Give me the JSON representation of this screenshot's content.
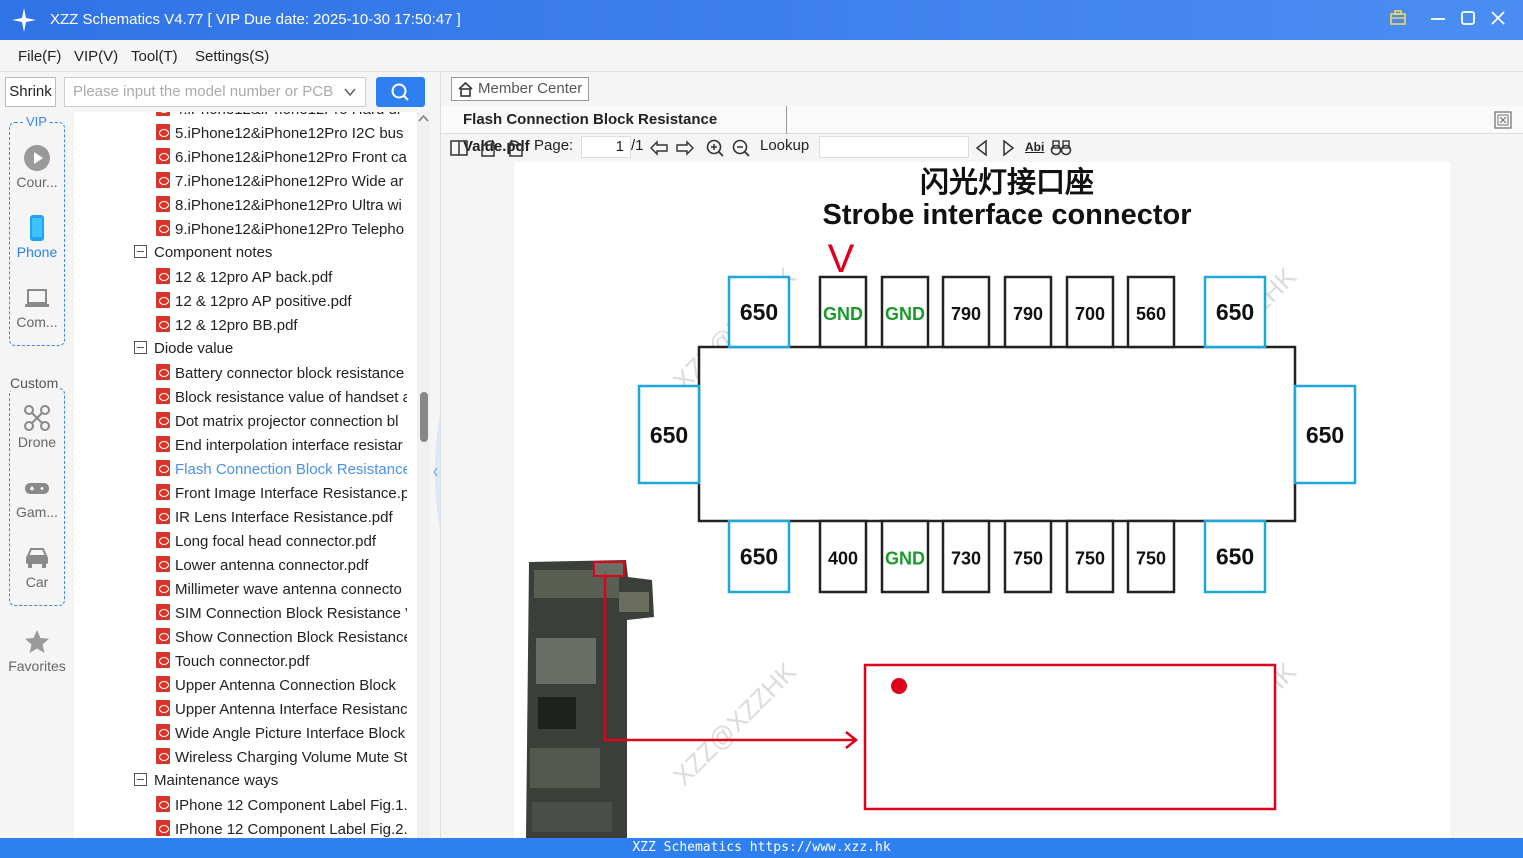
{
  "window": {
    "title": "XZZ Schematics V4.77 [ VIP Due date: 2025-10-30 17:50:47 ]"
  },
  "menu": [
    "File(F)",
    "VIP(V)",
    "Tool(T)",
    "Settings(S)"
  ],
  "left": {
    "shrink_label": "Shrink",
    "search_placeholder": "Please input the model number or PCB"
  },
  "sidebar": {
    "vip_label": "VIP",
    "custom_label": "Custom",
    "items": [
      {
        "label": "Cour...",
        "icon": "play-icon"
      },
      {
        "label": "Phone",
        "icon": "phone-icon"
      },
      {
        "label": "Com...",
        "icon": "laptop-icon"
      },
      {
        "label": "Drone",
        "icon": "drone-icon"
      },
      {
        "label": "Gam...",
        "icon": "gamepad-icon"
      },
      {
        "label": "Car",
        "icon": "car-icon"
      },
      {
        "label": "Favorites",
        "icon": "star-icon"
      }
    ]
  },
  "tree": {
    "rows": [
      {
        "type": "file",
        "label": "4.iPhone12&iPhone12Pro Hard di"
      },
      {
        "type": "file",
        "label": "5.iPhone12&iPhone12Pro I2C bus"
      },
      {
        "type": "file",
        "label": "6.iPhone12&iPhone12Pro Front ca"
      },
      {
        "type": "file",
        "label": "7.iPhone12&iPhone12Pro Wide ar"
      },
      {
        "type": "file",
        "label": "8.iPhone12&iPhone12Pro Ultra wi"
      },
      {
        "type": "file",
        "label": "9.iPhone12&iPhone12Pro Telepho"
      },
      {
        "type": "group",
        "label": "Component notes"
      },
      {
        "type": "file",
        "label": "12 & 12pro AP back.pdf"
      },
      {
        "type": "file",
        "label": "12 & 12pro AP positive.pdf"
      },
      {
        "type": "file",
        "label": "12 & 12pro BB.pdf"
      },
      {
        "type": "group",
        "label": "Diode value"
      },
      {
        "type": "file",
        "label": "Battery connector block resistance"
      },
      {
        "type": "file",
        "label": "Block resistance value of handset a"
      },
      {
        "type": "file",
        "label": "Dot matrix projector connection bl"
      },
      {
        "type": "file",
        "label": "End interpolation interface resistar"
      },
      {
        "type": "file",
        "label": "Flash Connection Block Resistance",
        "active": true
      },
      {
        "type": "file",
        "label": "Front Image Interface Resistance.p"
      },
      {
        "type": "file",
        "label": "IR Lens Interface Resistance.pdf"
      },
      {
        "type": "file",
        "label": "Long focal head connector.pdf"
      },
      {
        "type": "file",
        "label": "Lower antenna connector.pdf"
      },
      {
        "type": "file",
        "label": "Millimeter wave antenna connecto"
      },
      {
        "type": "file",
        "label": "SIM Connection Block Resistance V"
      },
      {
        "type": "file",
        "label": "Show Connection Block Resistance"
      },
      {
        "type": "file",
        "label": "Touch connector.pdf"
      },
      {
        "type": "file",
        "label": "Upper Antenna Connection Block"
      },
      {
        "type": "file",
        "label": "Upper Antenna Interface Resistanc"
      },
      {
        "type": "file",
        "label": "Wide Angle Picture Interface Block"
      },
      {
        "type": "file",
        "label": "Wireless Charging Volume Mute St"
      },
      {
        "type": "group",
        "label": "Maintenance ways"
      },
      {
        "type": "file",
        "label": "IPhone 12 Component Label Fig.1."
      },
      {
        "type": "file",
        "label": "IPhone 12 Component Label Fig.2."
      }
    ]
  },
  "viewer": {
    "member_center": "Member Center",
    "tab_title": "Flash Connection Block Resistance Value.pdf",
    "page_label": "Page:",
    "page_current": "1",
    "page_total": "/1",
    "lookup_label": "Lookup",
    "abi_label": "Abi"
  },
  "diagram": {
    "title_cn": "闪光灯接口座",
    "title_en": "Strobe interface connector",
    "top_pins": [
      "650",
      "GND",
      "GND",
      "790",
      "790",
      "700",
      "560",
      "650"
    ],
    "bottom_pins": [
      "650",
      "400",
      "GND",
      "730",
      "750",
      "750",
      "750",
      "650"
    ],
    "left_pin": "650",
    "right_pin": "650",
    "marker": "V",
    "watermark": "XZZ@XZZHK"
  },
  "status": {
    "text": "XZZ Schematics https://www.xzz.hk"
  }
}
